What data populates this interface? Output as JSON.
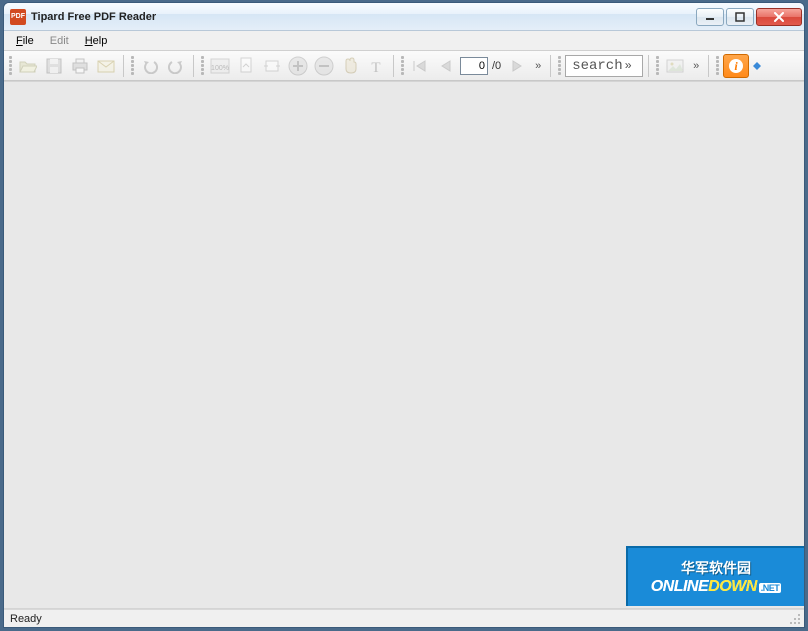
{
  "window": {
    "title": "Tipard Free PDF Reader",
    "app_icon_label": "PDF"
  },
  "menu": {
    "file": "File",
    "edit": "Edit",
    "help": "Help"
  },
  "toolbar": {
    "page_value": "0",
    "page_total": "/0",
    "search_placeholder": "search"
  },
  "status": {
    "text": "Ready"
  },
  "watermark": {
    "line1": "华军软件园",
    "line2a": "ONLINE",
    "line2b": "DOWN",
    "line2c": ".NET"
  }
}
